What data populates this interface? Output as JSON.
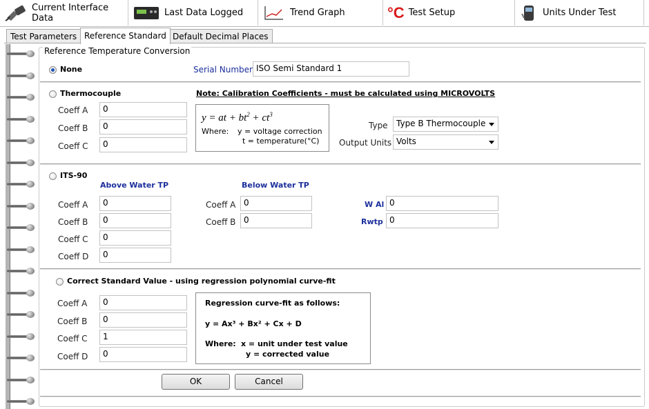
{
  "main_tabs": [
    {
      "label": "Current Interface Data",
      "icon": "cable-connector-icon"
    },
    {
      "label": "Last Data Logged",
      "icon": "data-logger-icon"
    },
    {
      "label": "Trend Graph",
      "icon": "trend-graph-icon"
    },
    {
      "label": "Test Setup",
      "icon": "degrees-celsius-icon",
      "glyph": "°C"
    },
    {
      "label": "Units Under Test",
      "icon": "handheld-device-icon"
    }
  ],
  "sub_tabs": [
    "Test Parameters",
    "Reference Standard",
    "Default Decimal Places"
  ],
  "active_sub_tab": "Reference Standard",
  "group_title": "Reference Temperature Conversion",
  "none_section": {
    "radio_label": "None",
    "selected": true,
    "serial_label": "Serial Number",
    "serial_value": "ISO Semi Standard 1"
  },
  "thermocouple": {
    "radio_label": "Thermocouple",
    "note": "Note:  Calibration Coefficients - must be calculated using MICROVOLTS",
    "coeff_labels": [
      "Coeff A",
      "Coeff B",
      "Coeff C"
    ],
    "coeff_values": [
      "0",
      "0",
      "0"
    ],
    "formula": "y = at + bt",
    "formula_sq": "2",
    "formula_mid": " + ct",
    "formula_cube": "3",
    "where_label": "Where:",
    "where_y": "y = voltage correction",
    "where_t": "t = temperature(°C)",
    "type_label": "Type",
    "type_value": "Type B Thermocouple",
    "output_label": "Output Units",
    "output_value": "Volts"
  },
  "its90": {
    "radio_label": "ITS-90",
    "above_label": "Above Water TP",
    "below_label": "Below Water TP",
    "above_coeff_labels": [
      "Coeff A",
      "Coeff B",
      "Coeff C",
      "Coeff D"
    ],
    "above_coeff_values": [
      "0",
      "0",
      "0",
      "0"
    ],
    "below_coeff_labels": [
      "Coeff A",
      "Coeff B"
    ],
    "below_coeff_values": [
      "0",
      "0"
    ],
    "wal_label": "W Al",
    "wal_value": "0",
    "rwtp_label": "Rwtp",
    "rwtp_value": "0"
  },
  "regression": {
    "radio_label": "Correct Standard Value - using regression polynomial curve-fit",
    "coeff_labels": [
      "Coeff A",
      "Coeff B",
      "Coeff C",
      "Coeff D"
    ],
    "coeff_values": [
      "0",
      "0",
      "1",
      "0"
    ],
    "box_title": "Regression curve-fit as follows:",
    "box_formula": "y = Ax³ + Bx² + Cx + D",
    "box_where": "Where:",
    "box_x": "x = unit under test value",
    "box_y": "y = corrected value"
  },
  "buttons": {
    "ok": "OK",
    "cancel": "Cancel"
  },
  "colors": {
    "label_blue": "#1c2f9c",
    "radio_selected": "#1d57b8",
    "test_setup_red": "#d81b1b"
  }
}
